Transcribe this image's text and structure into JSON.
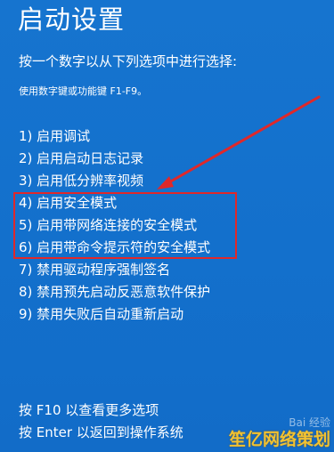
{
  "screen": {
    "title": "启动设置",
    "prompt": "按一个数字以从下列选项中进行选择:",
    "hint": "使用数字键或功能键 F1-F9。"
  },
  "options": [
    {
      "key": "1",
      "label": "1) 启用调试"
    },
    {
      "key": "2",
      "label": "2) 启用启动日志记录"
    },
    {
      "key": "3",
      "label": "3) 启用低分辨率视频"
    },
    {
      "key": "4",
      "label": "4) 启用安全模式"
    },
    {
      "key": "5",
      "label": "5) 启用带网络连接的安全模式"
    },
    {
      "key": "6",
      "label": "6) 启用带命令提示符的安全模式"
    },
    {
      "key": "7",
      "label": "7) 禁用驱动程序强制签名"
    },
    {
      "key": "8",
      "label": "8) 禁用预先启动反恶意软件保护"
    },
    {
      "key": "9",
      "label": "9) 禁用失败后自动重新启动"
    }
  ],
  "footer": {
    "f10": "按 F10 以查看更多选项",
    "enter": "按 Enter 以返回到操作系统"
  },
  "watermark": {
    "mark": "Bai 经验",
    "site": "笙亿网络策划"
  },
  "annotation": {
    "box_color": "#e0282a",
    "arrow_color": "#e0282a"
  },
  "colors": {
    "background": "#1570c9",
    "text": "#ffffff"
  }
}
